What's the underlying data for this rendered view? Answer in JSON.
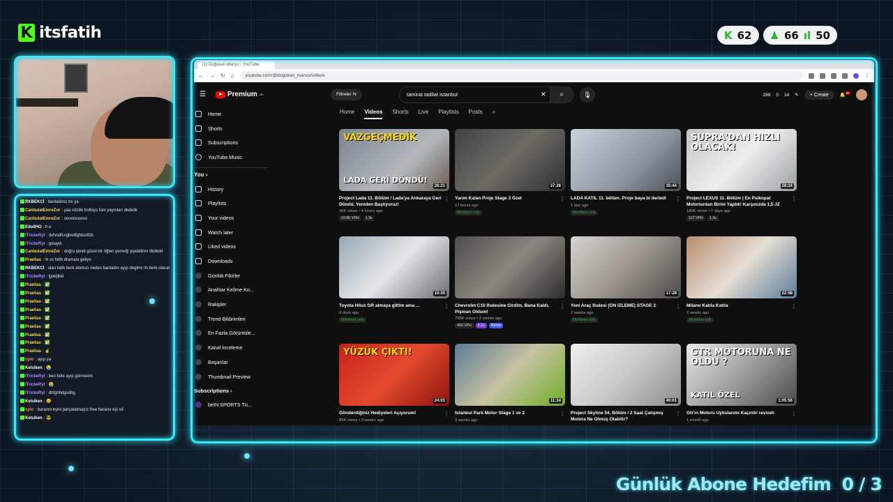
{
  "brand": {
    "name": "itsfatih",
    "logo_letter": "K"
  },
  "stats": [
    {
      "icon": "kick-icon",
      "value": "62"
    },
    {
      "icon": "user-icon",
      "value": "66"
    },
    {
      "icon": "bars-icon",
      "value": "50"
    }
  ],
  "chat": [
    {
      "user": "RKBEKCİ",
      "color": "#ffffff",
      "msg": "banladınız mı ya"
    },
    {
      "user": "CanbulatEmreZor",
      "color": "#ffd54a",
      "msg": "yaa sözde trollüyo tüm yayınları dkdkdk"
    },
    {
      "user": "CanbulatEmreZor",
      "color": "#ffd54a",
      "msg": "oooooooooo"
    },
    {
      "user": "EdolIHO",
      "color": "#ffffff",
      "msg": "h.o"
    },
    {
      "user": "ITrickeRyI",
      "color": "#b388ff",
      "msg": "dvfvsdfcvgbsdfghbsdfzb"
    },
    {
      "user": "ITrickeRyI",
      "color": "#b388ff",
      "msg": "golaydı"
    },
    {
      "user": "CanbulatEmreZor",
      "color": "#ffd54a",
      "msg": "doğru şimdi güzel bir öğlen yemeği yiyebilirim dkdkdd"
    },
    {
      "user": "Praelias",
      "color": "#ffd54a",
      "msg": "rk vs fatih draması geliyo"
    },
    {
      "user": "RKBEKCİ",
      "color": "#ffffff",
      "msg": "ulan fatih berk abımızı neden banladın ayıp degilmi its berk olacaktı belkıde"
    },
    {
      "user": "ITrickeRyI",
      "color": "#b388ff",
      "msg": "ljjokljlkkl"
    },
    {
      "user": "Praelias",
      "color": "#ffd54a",
      "msg": "✅"
    },
    {
      "user": "Praelias",
      "color": "#ffd54a",
      "msg": "✅"
    },
    {
      "user": "Praelias",
      "color": "#ffd54a",
      "msg": "✅"
    },
    {
      "user": "Praelias",
      "color": "#ffd54a",
      "msg": "✅"
    },
    {
      "user": "Praelias",
      "color": "#ffd54a",
      "msg": "✅"
    },
    {
      "user": "Praelias",
      "color": "#ffd54a",
      "msg": "✅"
    },
    {
      "user": "Praelias",
      "color": "#ffd54a",
      "msg": "✅"
    },
    {
      "user": "Praelias",
      "color": "#ffd54a",
      "msg": "✅"
    },
    {
      "user": "Praelias",
      "color": "#ffd54a",
      "msg": "☝"
    },
    {
      "user": "cpio",
      "color": "#ff8a65",
      "msg": "ayıp ya"
    },
    {
      "user": "Kelsiken",
      "color": "#ffffff",
      "msg": "😭"
    },
    {
      "user": "ITrickeRyI",
      "color": "#b388ff",
      "msg": "ben böle ayıp görmedm"
    },
    {
      "user": "ITrickeRyI",
      "color": "#b388ff",
      "msg": "😭"
    },
    {
      "user": "ITrickeRyI",
      "color": "#b388ff",
      "msg": "dhfghhdgsdhg"
    },
    {
      "user": "Kelsiken",
      "color": "#ffffff",
      "msg": "😄"
    },
    {
      "user": "cpio",
      "color": "#ff8a65",
      "msg": "baranın eşini parçalatmayız free baranıı eşi xd"
    },
    {
      "user": "Kelsiken",
      "color": "#ffffff",
      "msg": "😎"
    }
  ],
  "browser": {
    "tab": "(1) Doğukan Manço - YouTube",
    "url": "youtube.com/@dogukan_manco/videos"
  },
  "youtube": {
    "logo": "Premium",
    "region": "DE",
    "filter": "Filtreler",
    "search": "tamirat tadilat istanbul",
    "create": "Create",
    "notif": "9+",
    "counters": [
      "289",
      "0",
      "14"
    ],
    "sidebar_main": [
      "Home",
      "Shorts",
      "Subscriptions",
      "YouTube Music"
    ],
    "you_label": "You",
    "sidebar_you": [
      "History",
      "Playlists",
      "Your videos",
      "Watch later",
      "Liked videos",
      "Downloads"
    ],
    "sidebar_ext": [
      "Günlük Fikirler",
      "Anahtar Kelime Ko...",
      "Rakipler",
      "Trend Bildirimleri",
      "En Fazla Görüntüle...",
      "Kanal İnceleme",
      "Başarılar",
      "Thumbnail Preview"
    ],
    "subs_label": "Subscriptions",
    "sub_item": "beIN SPORTS Tü...",
    "tabs": [
      "Home",
      "Videos",
      "Shorts",
      "Live",
      "Playlists",
      "Posts"
    ],
    "videos": [
      {
        "title": "Project Lada 11. Bölüm / Lada'ya Ankaraya Geri Döndü. Yeniden Başlıyoruz!",
        "meta": "45K views • 4 hours ago",
        "dur": "26:21",
        "overlay": "VAZGEÇMEDİK",
        "overlay2": "LADA GERİ DÖNDÜ!",
        "tags": [
          "10.8K VPH",
          "1.3x"
        ],
        "bg": "linear-gradient(135deg,#7a8591,#b3b8bd 60%,#6a5d50)"
      },
      {
        "title": "Yarım Kalan Proje Stage 2 Özel",
        "meta": "17 hours ago",
        "dur": "37:28",
        "overlay": "",
        "overlay2": "",
        "tags": [
          "Members only"
        ],
        "bg": "linear-gradient(135deg,#3f4447,#6e6a63 50%,#2d2f31)"
      },
      {
        "title": "LADA KATIL 11. bölüm. Proje baya bi ilerledi",
        "meta": "1 day ago",
        "dur": "35:44",
        "overlay": "",
        "overlay2": "",
        "tags": [
          "Members only"
        ],
        "bg": "linear-gradient(135deg,#c9d3db,#8d95a0 60%,#4a4f57)"
      },
      {
        "title": "Project LEXUS 11. Bölüm | En Psikopat Motorlardan Birini Yaptık! Karşınızda 1,5 JZ",
        "meta": "180K views • 7 days ago",
        "dur": "28:24",
        "overlay": "SUPRA'DAN HIZLI OLACAK!",
        "overlay2": "",
        "tags": [
          "127 VPH",
          "1.3x"
        ],
        "bg": "linear-gradient(135deg,#c2c5c9,#eeeeee 50%,#9aa0a5)"
      },
      {
        "title": "Toyota Hilux GR almaya gittim ama ...",
        "meta": "8 days ago",
        "dur": "10:35",
        "overlay": "",
        "overlay2": "",
        "tags": [
          "Members only"
        ],
        "bg": "linear-gradient(135deg,#9aa9b5,#e3e6e8 50%,#6a6f74)"
      },
      {
        "title": "Chevrolet C10 İhalesine Girdim, Bana Kaldı, Pişman Oldum!",
        "meta": "790K views • 2 weeks ago",
        "dur": "",
        "overlay": "",
        "overlay2": "",
        "tags": [
          "460 VPH",
          "5.1x",
          "Remix"
        ],
        "bg": "linear-gradient(135deg,#4f4d4a,#8b867f 50%,#2e2d2b)"
      },
      {
        "title": "Yeni Araç İhalesi (ÖN İZLEME) STAGE 2",
        "meta": "2 weeks ago",
        "dur": "17:28",
        "overlay": "",
        "overlay2": "",
        "tags": [
          "Members only"
        ],
        "bg": "linear-gradient(135deg,#d6d4cf,#9c968e 50%,#4d4a46)"
      },
      {
        "title": "Milano Katıla Katıla",
        "meta": "2 weeks ago",
        "dur": "22:58",
        "overlay": "",
        "overlay2": "",
        "tags": [
          "Members only"
        ],
        "bg": "linear-gradient(135deg,#b98d6d,#e6ded3 50%,#5c7b9a)"
      },
      {
        "title": "Gönderdiğiniz Hediyeleri Açıyorum!",
        "meta": "85K views • 3 weeks ago",
        "dur": "24:01",
        "overlay": "YÜZÜK ÇIKTI!",
        "overlay2": "",
        "tags": [],
        "bg": "linear-gradient(135deg,#c7221b,#e64a2e 50%,#8c1410)"
      },
      {
        "title": "İstanbul Park Motor Stage 1 ve 2",
        "meta": "3 weeks ago",
        "dur": "11:14",
        "overlay": "",
        "overlay2": "",
        "tags": [],
        "bg": "linear-gradient(135deg,#5c7e96,#c7c2a1 50%,#6fae2a)"
      },
      {
        "title": "Project Skyline 54. Bölüm / 2 Saat Çalışmış Motora Ne Olmuş Olabilir?",
        "meta": "",
        "dur": "40:01",
        "overlay": "",
        "overlay2": "",
        "tags": [],
        "bg": "linear-gradient(135deg,#efefef,#c9c9c9 50%,#8d8d8d)"
      },
      {
        "title": "Gtr'ın Motoru Uykularımı Kaçırdı! revizeli",
        "meta": "1 month ago",
        "dur": "1:05:56",
        "overlay": "GTR MOTORUNA NE OLDU ?",
        "overlay2": "KATIL ÖZEL",
        "tags": [],
        "bg": "linear-gradient(135deg,#e8e8e8,#9d9d9d 50%,#4a4a4a)"
      }
    ]
  },
  "goal": {
    "label": "Günlük Abone Hedefim",
    "value": "0 / 3"
  },
  "colors": {
    "neon": "#3fe8f6",
    "kick_green": "#53fc18",
    "yt_red": "#ff0000"
  }
}
